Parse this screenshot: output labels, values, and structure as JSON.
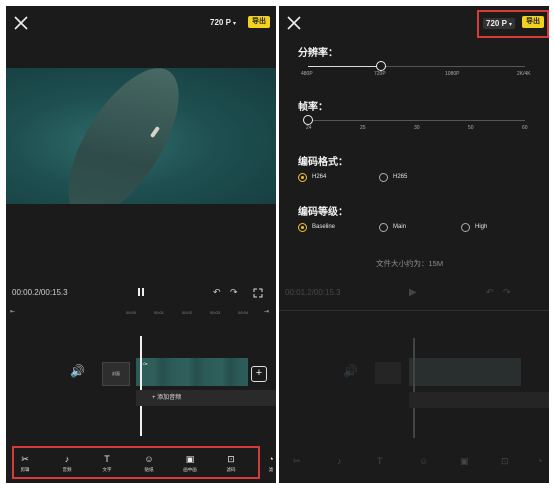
{
  "left": {
    "resolution": "720 P",
    "dropdown_caret": "▾",
    "export": "导出",
    "timecode": "00:00.2/00:15.3",
    "ticks": [
      "00:00",
      "00:01",
      "00:02",
      "00:03",
      "00:04"
    ],
    "clip_speed": "1.0x",
    "clip_cover_label": "封面",
    "add_audio": "+  添加音频",
    "tools": [
      {
        "icon": "scissors-icon",
        "label": "剪辑"
      },
      {
        "icon": "music-note-icon",
        "label": "音频"
      },
      {
        "icon": "text-icon",
        "label": "文字"
      },
      {
        "icon": "sticker-icon",
        "label": "贴纸"
      },
      {
        "icon": "picture-in-picture-icon",
        "label": "画中画"
      },
      {
        "icon": "effects-icon",
        "label": "滤码"
      },
      {
        "icon": "filter-icon",
        "label": "滤"
      }
    ]
  },
  "right": {
    "resolution": "720 P",
    "dropdown_caret": "▾",
    "export": "导出",
    "resolution_title": "分辨率：",
    "resolution_ticks": [
      "480P",
      "720P",
      "1080P",
      "2K/4K"
    ],
    "resolution_value": "720P",
    "framerate_title": "帧率：",
    "framerate_ticks": [
      "24",
      "25",
      "30",
      "50",
      "60"
    ],
    "framerate_value": "24",
    "codec_title": "编码格式：",
    "codec_options": [
      "H264",
      "H265"
    ],
    "codec_selected": "H264",
    "level_title": "编码等级：",
    "level_options": [
      "Baseline",
      "Main",
      "High"
    ],
    "level_selected": "Baseline",
    "file_size": "文件大小约为：15M",
    "dim_timecode": "00:01.2/00:15.3"
  },
  "colors": {
    "accent": "#f2d21e",
    "highlight": "#d63a3a",
    "panel_bg": "#1b1b1b"
  }
}
